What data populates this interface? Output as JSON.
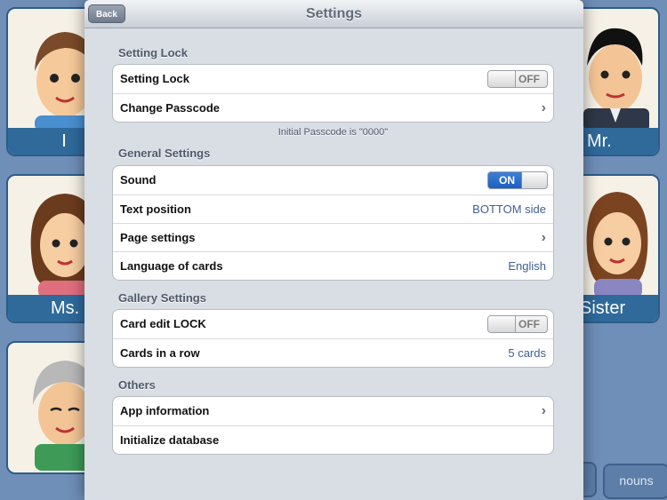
{
  "background": {
    "cards": [
      {
        "caption": "I"
      },
      {
        "caption": "Mr."
      },
      {
        "caption": "Ms."
      },
      {
        "caption": "Sister"
      },
      {
        "caption": ""
      }
    ],
    "tab_label": "nouns"
  },
  "navbar": {
    "title": "Settings",
    "back_label": "Back"
  },
  "setting_lock": {
    "header": "Setting Lock",
    "rows": {
      "lock_label": "Setting Lock",
      "lock_state": "OFF",
      "passcode_label": "Change Passcode"
    },
    "footnote": "Initial Passcode is \"0000\""
  },
  "general": {
    "header": "General Settings",
    "sound_label": "Sound",
    "sound_state": "ON",
    "text_position_label": "Text position",
    "text_position_value": "BOTTOM side",
    "page_settings_label": "Page settings",
    "language_label": "Language of cards",
    "language_value": "English"
  },
  "gallery": {
    "header": "Gallery Settings",
    "edit_lock_label": "Card edit LOCK",
    "edit_lock_state": "OFF",
    "cards_row_label": "Cards in a row",
    "cards_row_value": "5 cards"
  },
  "others": {
    "header": "Others",
    "app_info_label": "App information",
    "init_db_label": "Initialize database"
  },
  "icons": {
    "chevron": "›"
  },
  "colors": {
    "accent_blue": "#2f6a9b",
    "toggle_on": "#2a6fcf",
    "value_text": "#3f5f94"
  }
}
